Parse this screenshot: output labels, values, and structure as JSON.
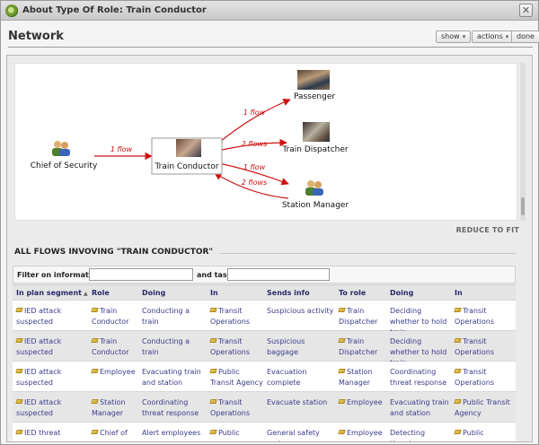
{
  "window": {
    "title": "About Type Of Role: Train Conductor",
    "close_glyph": "✕"
  },
  "header": {
    "title": "Network",
    "buttons": [
      {
        "label": "show",
        "caret": "▾"
      },
      {
        "label": "actions",
        "caret": "▾"
      },
      {
        "label": "done"
      }
    ]
  },
  "diagram": {
    "nodes": {
      "chief": "Chief of Security",
      "conductor": "Train Conductor",
      "passenger": "Passenger",
      "dispatcher": "Train Dispatcher",
      "station": "Station Manager"
    },
    "edges": {
      "chief_to_conductor": "1 flow",
      "conductor_to_passenger": "1 flow",
      "conductor_to_dispatcher": "2 flows",
      "conductor_to_station": "1 flow",
      "station_to_conductor": "2 flows"
    },
    "reduce_label": "REDUCE TO FIT",
    "edge_color": "#cc1111"
  },
  "flows": {
    "title": "ALL FLOWS INVOVING \"TRAIN CONDUCTOR\"",
    "filter": {
      "info_label": "Filter on information:",
      "task_label": "and task:",
      "info_value": "",
      "task_value": ""
    },
    "headers": [
      "In plan segment",
      "Role",
      "Doing",
      "In",
      "Sends info",
      "To role",
      "Doing",
      "In"
    ],
    "rows": [
      [
        "IED attack suspected",
        "Train Conductor",
        "Conducting a train",
        "Transit Operations",
        "Suspicious activity",
        "Train Dispatcher",
        "Deciding whether to hold train",
        "Transit Operations"
      ],
      [
        "IED attack suspected",
        "Train Conductor",
        "Conducting a train",
        "Transit Operations",
        "Suspicious baggage",
        "Train Dispatcher",
        "Deciding whether to hold train",
        "Transit Operations"
      ],
      [
        "IED attack suspected",
        "Employee",
        "Evacuating train and station",
        "Public Transit Agency",
        "Evacuation complete",
        "Station Manager",
        "Coordinating threat response",
        "Transit Operations"
      ],
      [
        "IED attack suspected",
        "Station Manager",
        "Coordinating threat response",
        "Transit Operations",
        "Evacuate station",
        "Employee",
        "Evacuating train and station",
        "Public Transit Agency"
      ],
      [
        "IED threat",
        "Chief of",
        "Alert employees",
        "Public",
        "General safety and",
        "Employee",
        "Detecting threats",
        "Public"
      ]
    ]
  }
}
